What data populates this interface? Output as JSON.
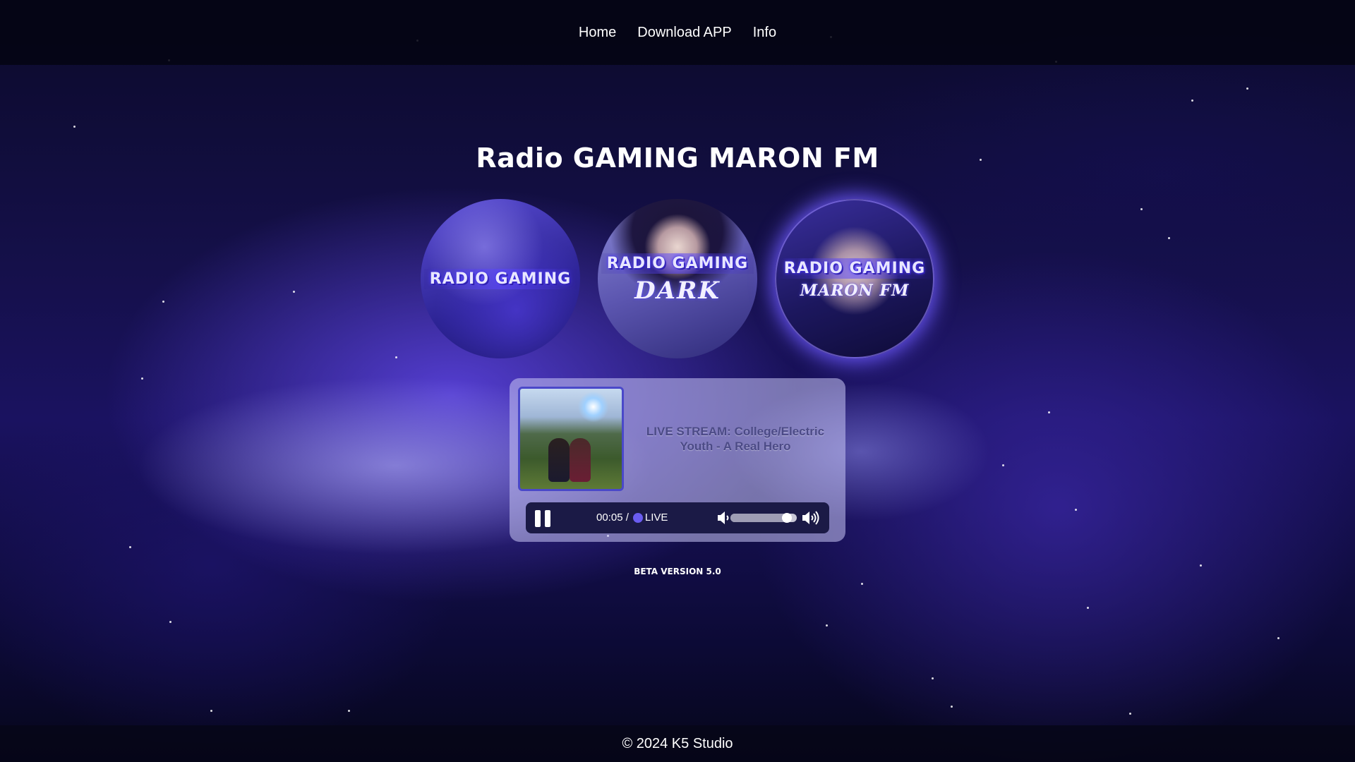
{
  "nav": {
    "items": [
      {
        "label": "Home"
      },
      {
        "label": "Download APP"
      },
      {
        "label": "Info"
      }
    ]
  },
  "page": {
    "title": "Radio GAMING MARON FM"
  },
  "stations": [
    {
      "logo": "RADIO GAMING",
      "sub": ""
    },
    {
      "logo": "RADIO GAMING",
      "sub": "DARK"
    },
    {
      "logo": "RADIO GAMING",
      "sub": "MARON FM"
    }
  ],
  "player": {
    "now_playing": "LIVE STREAM: College/Electric Youth - A Real Hero",
    "elapsed": "00:05 /",
    "live_label": "LIVE",
    "volume_level": 0.85,
    "icons": {
      "play_state": "pause-icon",
      "volume_low": "volume-low-icon",
      "volume_high": "volume-high-icon"
    }
  },
  "version": "BETA VERSION 5.0",
  "footer": {
    "copyright": "© 2024 K5 Studio"
  }
}
